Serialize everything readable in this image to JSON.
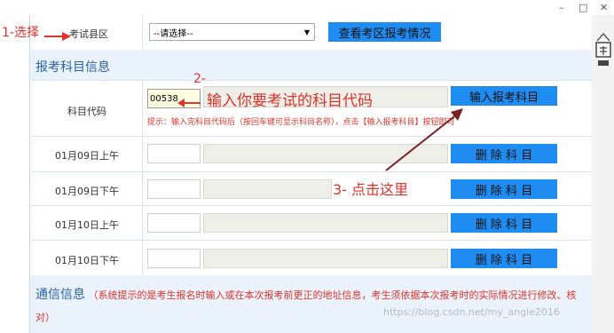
{
  "annotations": {
    "step1": "1-选择",
    "step2": "2-",
    "step3": "3- 点击这里",
    "input_hint": "输入你要考试的科目代码"
  },
  "region": {
    "label": "考试县区",
    "select_value": "--请选择--",
    "button": "查看考区报考情况"
  },
  "subject_section": {
    "title": "报考科目信息",
    "code_label": "科目代码",
    "code_value": "00538",
    "enter_button": "输入报考科目",
    "hint": "提示：输入完科目代码后（按回车键可显示科目名称），点击【输入报考科目】按钮即可",
    "rows": [
      {
        "time": "01月09日上午",
        "button": "删 除 科 目"
      },
      {
        "time": "01月09日下午",
        "button": "删 除 科 目"
      },
      {
        "time": "01月10日上午",
        "button": "删 除 科 目"
      },
      {
        "time": "01月10日下午",
        "button": "删 除 科 目"
      }
    ]
  },
  "contact_section": {
    "title": "通信信息",
    "note": "（系统提示的是考生报名时输入或在本次报考前更正的地址信息，考生须依据本次报考时的实际情况进行修改、核对）"
  },
  "watermark": "https://blog.csdn.net/my_angle2016",
  "colors": {
    "button_blue": "#1e8cf0",
    "annotation_red": "#e0332a",
    "section_bg": "#eaf2fb"
  }
}
